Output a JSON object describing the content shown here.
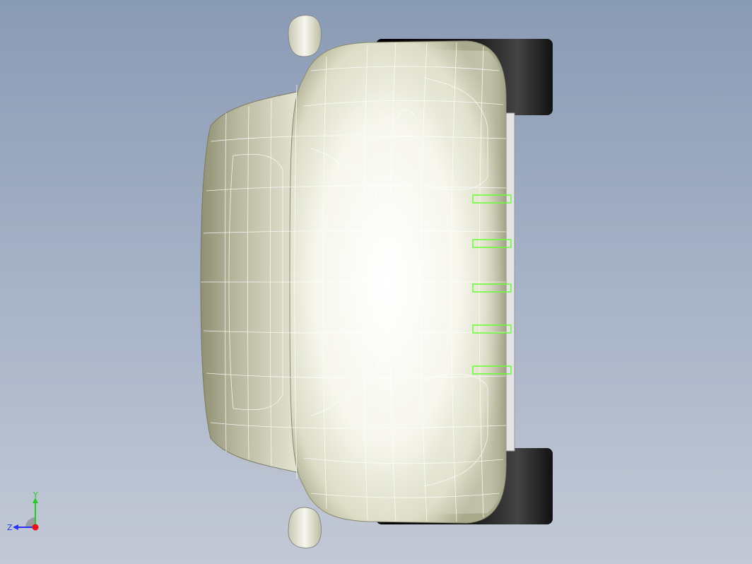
{
  "viewport": {
    "background_top": "#8a9bb5",
    "background_bottom": "#c3c9d6"
  },
  "model": {
    "body_color": "#f2f2e6",
    "shadow_color": "#b9b99e",
    "tire_color": "#0a0a0a",
    "wire_color": "#ffffff",
    "highlight_color": "#66ff33",
    "highlight_count": 5
  },
  "triad": {
    "y_label": "Y",
    "z_label": "Z",
    "y_color": "#22cc22",
    "z_color": "#2233ff",
    "x_color": "#ee1111"
  }
}
